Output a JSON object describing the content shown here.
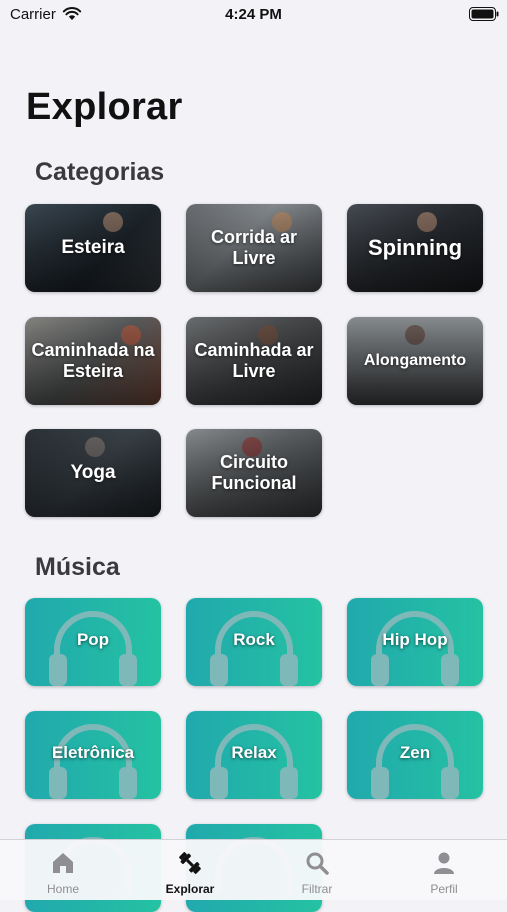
{
  "status_bar": {
    "carrier": "Carrier",
    "time": "4:24 PM"
  },
  "page": {
    "title": "Explorar"
  },
  "categories": {
    "title": "Categorias",
    "items": [
      {
        "label": "Esteira",
        "icon": "running-person-photo"
      },
      {
        "label": "Corrida ar Livre",
        "icon": "running-person-photo"
      },
      {
        "label": "Spinning",
        "icon": "cycling-person-photo"
      },
      {
        "label": "Caminhada na Esteira",
        "icon": "walking-person-photo"
      },
      {
        "label": "Caminhada ar Livre",
        "icon": "walking-person-photo"
      },
      {
        "label": "Alongamento",
        "icon": "stretching-person-photo"
      },
      {
        "label": "Yoga",
        "icon": "yoga-person-photo"
      },
      {
        "label": "Circuito Funcional",
        "icon": "training-person-photo"
      }
    ]
  },
  "music": {
    "title": "Música",
    "items": [
      {
        "label": "Pop",
        "icon": "headphones-icon"
      },
      {
        "label": "Rock",
        "icon": "headphones-icon"
      },
      {
        "label": "Hip Hop",
        "icon": "headphones-icon"
      },
      {
        "label": "Eletrônica",
        "icon": "headphones-icon"
      },
      {
        "label": "Relax",
        "icon": "headphones-icon"
      },
      {
        "label": "Zen",
        "icon": "headphones-icon"
      }
    ]
  },
  "tab_bar": {
    "items": [
      {
        "label": "Home",
        "icon": "home-icon",
        "active": false
      },
      {
        "label": "Explorar",
        "icon": "dumbbell-icon",
        "active": true
      },
      {
        "label": "Filtrar",
        "icon": "search-icon",
        "active": false
      },
      {
        "label": "Perfil",
        "icon": "person-icon",
        "active": false
      }
    ]
  },
  "colors": {
    "music_tile_start": "#21a9ad",
    "music_tile_end": "#24c2a2",
    "background": "#f2f2f7",
    "tab_inactive": "#8e8e93",
    "tab_active": "#111111"
  }
}
